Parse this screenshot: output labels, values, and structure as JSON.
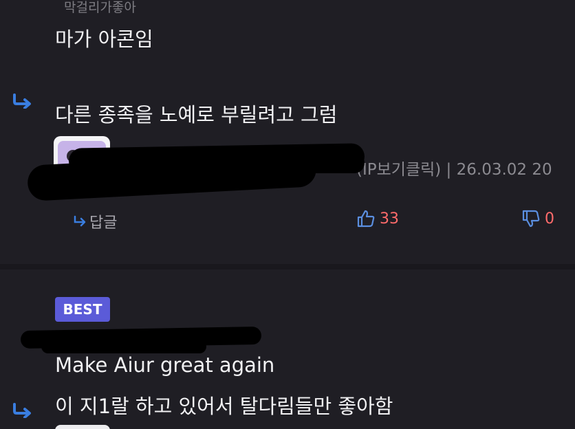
{
  "comment1": {
    "nickname": "막걸리가좋아",
    "text": "마가 아콘임",
    "reply_text": "다른 종족을 노예로 부릴려고 그럼",
    "meta": "(IP보기클릭) | 26.03.02 20",
    "reply_label": "답글",
    "likes": "33",
    "dislikes": "0"
  },
  "comment2": {
    "badge": "BEST",
    "text": "Make Aiur great again",
    "reply_text": "이 지1랄 하고 있어서 탈다림들만 좋아함"
  },
  "colors": {
    "background": "#1f1e24",
    "accent": "#5b5bd8",
    "reply_arrow": "#3a7ee0",
    "like_count": "#ff6b6b",
    "avatar": "#c6b3e8"
  },
  "icons": {
    "reply": "reply-arrow-icon",
    "like": "thumbs-up-icon",
    "dislike": "thumbs-down-icon"
  }
}
